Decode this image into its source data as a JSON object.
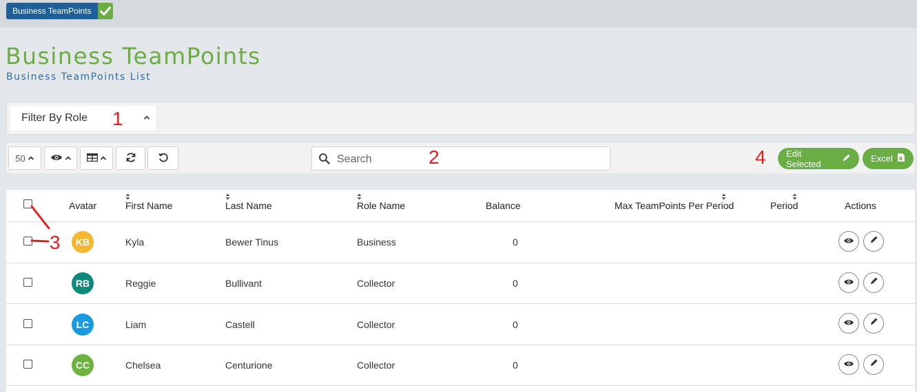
{
  "breadcrumb": {
    "label": "Business TeamPoints"
  },
  "page": {
    "title": "Business TeamPoints",
    "subtitle": "Business TeamPoints List"
  },
  "filter": {
    "label": "Filter By Role"
  },
  "toolbar": {
    "page_size": "50",
    "search_placeholder": "Search",
    "edit_selected_label": "Edit Selected",
    "excel_label": "Excel"
  },
  "annotations": {
    "a1": "1",
    "a2": "2",
    "a3": "3",
    "a4": "4"
  },
  "table": {
    "headers": {
      "avatar": "Avatar",
      "first_name": "First Name",
      "last_name": "Last Name",
      "role_name": "Role Name",
      "balance": "Balance",
      "max_points": "Max TeamPoints Per Period",
      "period": "Period",
      "actions": "Actions"
    },
    "rows": [
      {
        "initials": "KB",
        "avatar_color": "#f5b731",
        "first": "Kyla",
        "last": "Bewer Tinus",
        "role": "Business",
        "balance": "0"
      },
      {
        "initials": "RB",
        "avatar_color": "#0e8a7c",
        "first": "Reggie",
        "last": "Bullivant",
        "role": "Collector",
        "balance": "0"
      },
      {
        "initials": "LC",
        "avatar_color": "#1a9be0",
        "first": "Liam",
        "last": "Castell",
        "role": "Collector",
        "balance": "0"
      },
      {
        "initials": "CC",
        "avatar_color": "#6db33f",
        "first": "Chelsea",
        "last": "Centurione",
        "role": "Collector",
        "balance": "0"
      }
    ]
  },
  "colors": {
    "brand_green": "#6aad45",
    "brand_blue": "#1f5f97",
    "annotation_red": "#e02020"
  }
}
